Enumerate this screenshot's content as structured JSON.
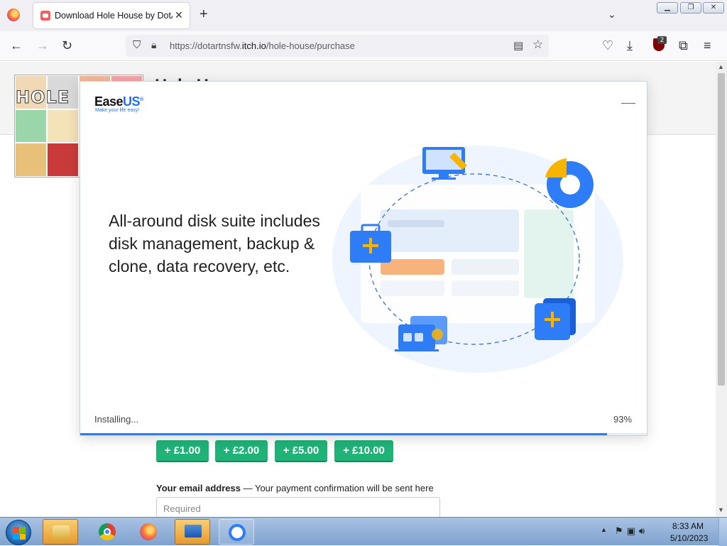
{
  "browser": {
    "tab_title": "Download Hole House by DotA",
    "tab_close": "✕",
    "new_tab": "+",
    "url_prefix": "https://dotartnsfw.",
    "url_domain": "itch.io",
    "url_path": "/hole-house/purchase",
    "ublock_count": "2"
  },
  "page": {
    "title_partial": "Hole H",
    "cover_logo": "HOLE",
    "amount_buttons": [
      "+ £1.00",
      "+ £2.00",
      "+ £5.00",
      "+ £10.00"
    ],
    "email_label_bold": "Your email address",
    "email_label_rest": " — Your payment confirmation will be sent here",
    "email_placeholder": "Required"
  },
  "installer": {
    "brand_main": "Ease",
    "brand_accent": "US",
    "brand_mark": "®",
    "tagline": "Make your life easy!",
    "headline": "All-around disk suite includes disk management, backup & clone, data recovery, etc.",
    "status": "Installing...",
    "percent_label": "93%",
    "progress": 0.93,
    "accent_color": "#2e7cf6"
  },
  "taskbar": {
    "time": "8:33 AM",
    "date": "5/10/2023",
    "apps": [
      "windows-explorer",
      "google-chrome",
      "firefox",
      "remote-desktop",
      "easeus-installer"
    ]
  }
}
